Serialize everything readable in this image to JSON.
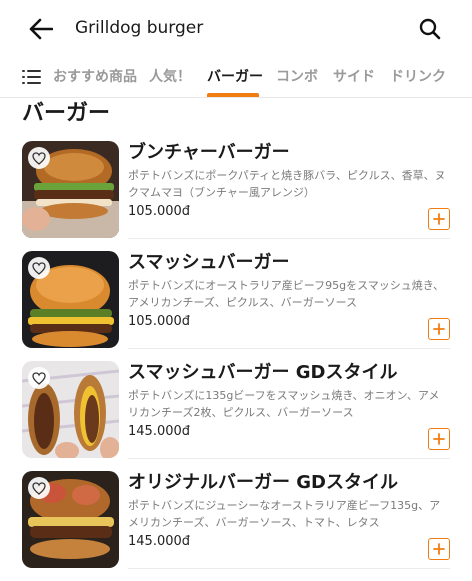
{
  "header": {
    "title": "Grilldog burger",
    "back_icon": "arrow-left-icon",
    "search_icon": "search-icon"
  },
  "tabs": {
    "menu_icon": "list-menu-icon",
    "items": [
      {
        "label": "おすすめ商品",
        "active": false
      },
      {
        "label": "人気！",
        "active": false
      },
      {
        "label": "バーガー",
        "active": true
      },
      {
        "label": "コンボ",
        "active": false
      },
      {
        "label": "サイド",
        "active": false
      },
      {
        "label": "ドリンク",
        "active": false
      }
    ]
  },
  "section": {
    "title": "バーガー"
  },
  "items": [
    {
      "name": "ブンチャーバーガー",
      "description": "ポテトバンズにポークパティと焼き豚バラ、ピクルス、香草、ヌクマムマヨ（ブンチャー風アレンジ）",
      "price": "105.000đ"
    },
    {
      "name": "スマッシュバーガー",
      "description": "ポテトバンズにオーストラリア産ビーフ95gをスマッシュ焼き、アメリカンチーズ、ピクルス、バーガーソース",
      "price": "105.000đ"
    },
    {
      "name": "スマッシュバーガー GDスタイル",
      "description": "ポテトバンズに135gビーフをスマッシュ焼き、オニオン、アメリカンチーズ2枚、ピクルス、バーガーソース",
      "price": "145.000đ"
    },
    {
      "name": "オリジナルバーガー GDスタイル",
      "description": "ポテトバンズにジューシーなオーストラリア産ビーフ135g、アメリカンチーズ、バーガーソース、トマト、レタス",
      "price": "145.000đ"
    }
  ],
  "colors": {
    "accent": "#f07d12",
    "muted": "#9a9a9a"
  }
}
